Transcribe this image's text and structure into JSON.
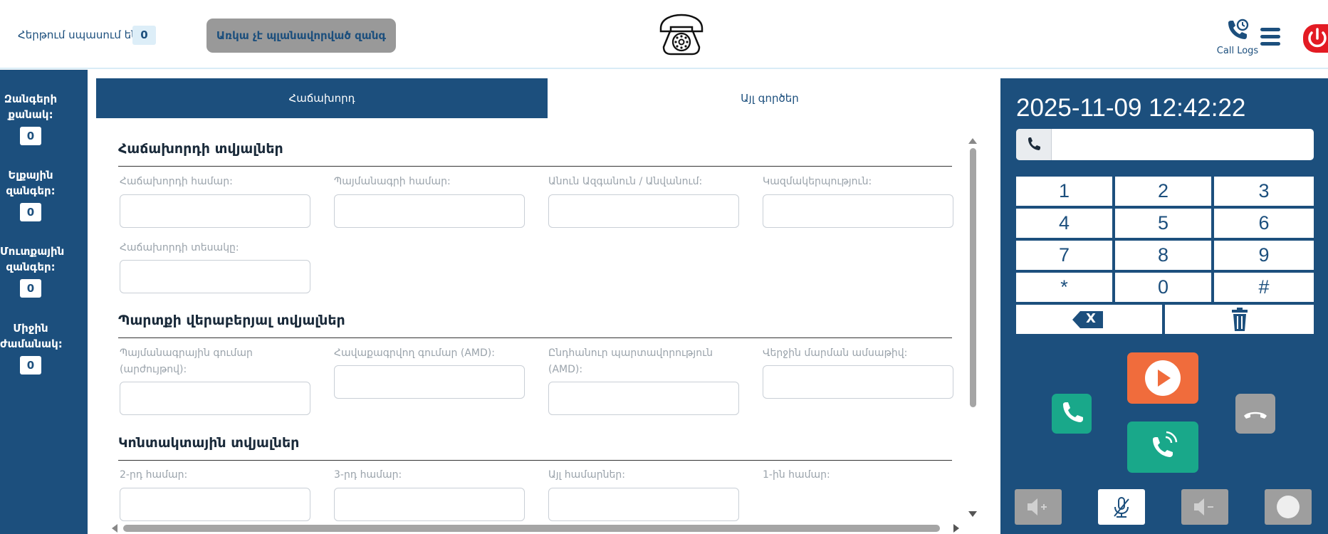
{
  "header": {
    "queue_label": "Հերթում սպասում են:",
    "queue_count": "0",
    "scheduled_button": "Առկա չէ պլանավորված զանգ",
    "call_logs_label": "Call Logs"
  },
  "sidebar": {
    "stats": [
      {
        "label_line1": "Զանգերի",
        "label_line2": "քանակ:",
        "count": "0"
      },
      {
        "label_line1": "Ելքային",
        "label_line2": "զանգեր:",
        "count": "0"
      },
      {
        "label_line1": "Մուտքային",
        "label_line2": "զանգեր:",
        "count": "0"
      },
      {
        "label_line1": "Միջին",
        "label_line2": "ժամանակ:",
        "count": "0"
      }
    ]
  },
  "tabs": {
    "customer": "Հաճախորդ",
    "other": "Այլ գործեր"
  },
  "sections": {
    "customer_data": {
      "title": "Հաճախորդի տվյալներ",
      "fields": [
        {
          "label": "Հաճախորդի համար:",
          "value": ""
        },
        {
          "label": "Պայմանագրի համար:",
          "value": ""
        },
        {
          "label": "Անուն Ազգանուն / Անվանում:",
          "value": ""
        },
        {
          "label": "Կազմակերպություն:",
          "value": ""
        },
        {
          "label": "Հաճախորդի տեսակը:",
          "value": ""
        }
      ]
    },
    "debt_data": {
      "title": "Պարտքի վերաբերյալ տվյալներ",
      "fields": [
        {
          "label": "Պայմանագրային գումար (արժույթով):",
          "value": ""
        },
        {
          "label": "Հավաքագրվող գումար (AMD):",
          "value": ""
        },
        {
          "label": "Ընդհանուր պարտավորություն (AMD):",
          "value": ""
        },
        {
          "label": "Վերջին մարման ամսաթիվ:",
          "value": ""
        }
      ]
    },
    "contact_data": {
      "title": "Կոնտակտային տվյալներ",
      "fields": [
        {
          "label": "2-րդ համար:",
          "value": ""
        },
        {
          "label": "3-րդ համար:",
          "value": ""
        },
        {
          "label": "Այլ համարներ:",
          "value": ""
        },
        {
          "label": "1-ին համար:",
          "value": ""
        }
      ]
    }
  },
  "dialer": {
    "datetime": "2025-11-09 12:42:22",
    "number_value": "",
    "keys": [
      "1",
      "2",
      "3",
      "4",
      "5",
      "6",
      "7",
      "8",
      "9",
      "*",
      "0",
      "#"
    ],
    "backspace_label": "X"
  },
  "colors": {
    "primary": "#1c4f7d",
    "call_green": "#19a88a",
    "play_orange": "#f06c3c",
    "power_red": "#e31b23",
    "disabled_gray": "#9e9e9e"
  },
  "icons": [
    "phone-logo-icon",
    "call-logs-icon",
    "menu-icon",
    "power-icon",
    "phone-icon",
    "play-icon",
    "hangup-icon",
    "volume-up-icon",
    "mic-off-icon",
    "volume-down-icon",
    "record-icon",
    "trash-icon",
    "backspace-icon"
  ]
}
